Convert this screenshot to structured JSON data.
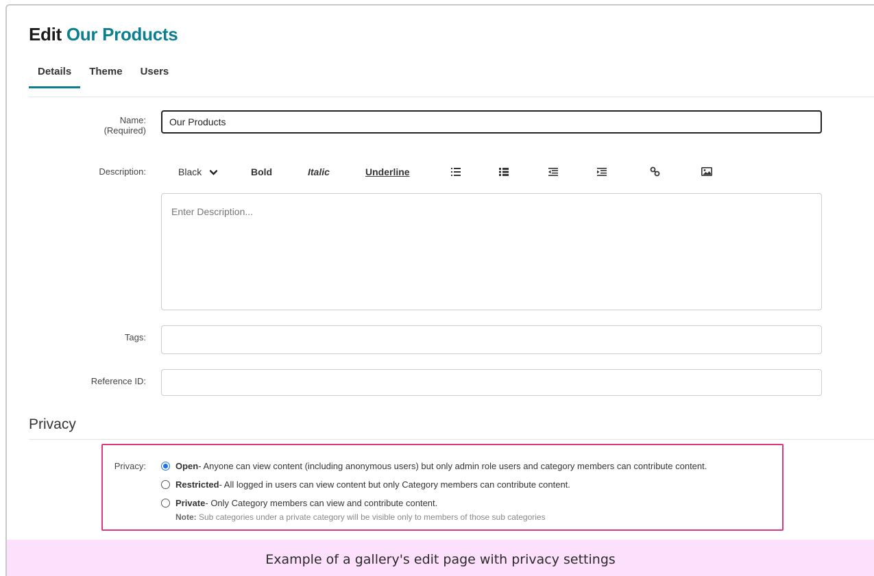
{
  "header": {
    "title_prefix": "Edit",
    "title_name": "Our Products"
  },
  "tabs": [
    {
      "label": "Details",
      "active": true
    },
    {
      "label": "Theme",
      "active": false
    },
    {
      "label": "Users",
      "active": false
    }
  ],
  "form": {
    "name_label": "Name:",
    "name_required": "(Required)",
    "name_value": "Our Products",
    "description_label": "Description:",
    "description_placeholder": "Enter Description...",
    "tags_label": "Tags:",
    "reference_label": "Reference ID:"
  },
  "toolbar": {
    "color": "Black",
    "bold": "Bold",
    "italic": "Italic",
    "underline": "Underline"
  },
  "privacy": {
    "section_title": "Privacy",
    "label": "Privacy:",
    "options": [
      {
        "name": "Open",
        "text": " - Anyone can view content (including anonymous users) but only admin role users and category members can contribute content.",
        "checked": true
      },
      {
        "name": "Restricted",
        "text": " - All logged in users can view content but only Category members can contribute content.",
        "checked": false
      },
      {
        "name": "Private",
        "text": " - Only Category members can view and contribute content.",
        "checked": false
      }
    ],
    "note_label": "Note:",
    "note_text": " Sub categories under a private category will be visible only to members of those sub categories"
  },
  "caption": "Example of a gallery's edit page with privacy settings",
  "colors": {
    "accent": "#0b7f8e",
    "highlight_border": "#e0357f",
    "caption_bg": "#fde0fb",
    "radio_checked": "#1a73e8"
  }
}
